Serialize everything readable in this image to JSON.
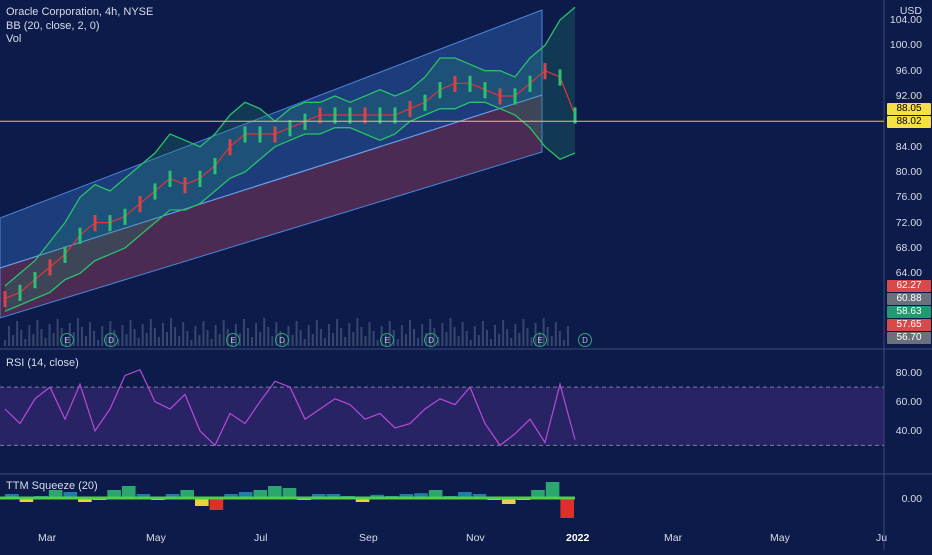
{
  "legend": {
    "title": "Oracle Corporation, 4h, NYSE",
    "bb": "BB (20, close, 2, 0)",
    "vol": "Vol",
    "rsi": "RSI (14, close)",
    "ttm": "TTM Squeeze (20)"
  },
  "currency": "USD",
  "price_axis": [
    "104.00",
    "100.00",
    "96.00",
    "92.00",
    "88.00",
    "84.00",
    "80.00",
    "76.00",
    "72.00",
    "68.00",
    "64.00"
  ],
  "price_tags": {
    "p1": "88.05",
    "p2": "88.02",
    "v1": "62.27",
    "v2": "60.88",
    "v3": "58.63",
    "v4": "57.65",
    "v5": "56.70"
  },
  "rsi_axis": [
    "80.00",
    "60.00",
    "40.00"
  ],
  "ttm_axis": "0.00",
  "x_axis": [
    "Mar",
    "May",
    "Jul",
    "Sep",
    "Nov",
    "2022",
    "Mar",
    "May",
    "Ju"
  ],
  "events": [
    "E",
    "D",
    "E",
    "D",
    "E",
    "D",
    "E",
    "D"
  ],
  "colors": {
    "background": "#0d1b4b",
    "channel_upper": "#2f66b8",
    "channel_lower": "#8a3b5c",
    "bb_band": "#27c36a",
    "bb_mid": "#e0343b",
    "rsi": "#b94ad6",
    "price_line": "#e8c84a",
    "tag_price": "#f5e046",
    "tag_red": "#d84a4a",
    "tag_gray": "#6c6f7c",
    "tag_green": "#1f9a73"
  },
  "chart_data": {
    "type": "line",
    "title": "Oracle Corporation, 4h, NYSE",
    "price_range": [
      60,
      106
    ],
    "last_price": 88.02,
    "bb_upper": [
      62,
      64,
      66,
      69,
      72,
      76,
      78,
      77,
      79,
      81,
      83,
      86,
      85,
      84,
      86,
      89,
      91,
      90,
      88,
      90,
      91,
      91,
      92,
      91,
      92,
      93,
      92,
      93,
      95,
      98,
      98,
      97,
      96,
      96,
      95,
      98,
      100,
      104,
      106
    ],
    "bb_mid": [
      60,
      61,
      63,
      65,
      67,
      70,
      72,
      72,
      73,
      75,
      77,
      79,
      78,
      79,
      81,
      84,
      86,
      86,
      86,
      87,
      88,
      89,
      89,
      89,
      89,
      89,
      89,
      90,
      91,
      93,
      94,
      94,
      93,
      92,
      92,
      94,
      96,
      95,
      89
    ],
    "bb_lower": [
      58,
      59,
      60,
      61,
      63,
      64,
      66,
      67,
      68,
      70,
      72,
      74,
      74,
      75,
      77,
      79,
      80,
      82,
      84,
      85,
      86,
      86,
      87,
      87,
      86,
      85,
      86,
      88,
      89,
      90,
      90,
      91,
      91,
      90,
      89,
      87,
      84,
      82,
      83
    ],
    "rsi_range": [
      20,
      90
    ],
    "rsi": [
      55,
      45,
      62,
      70,
      48,
      72,
      40,
      55,
      78,
      82,
      60,
      55,
      65,
      40,
      30,
      52,
      45,
      60,
      74,
      70,
      48,
      55,
      62,
      58,
      48,
      52,
      42,
      45,
      55,
      62,
      58,
      70,
      45,
      30,
      38,
      48,
      32,
      72,
      34
    ],
    "ttm": [
      1,
      -1,
      0.5,
      2,
      1.5,
      -1,
      -0.5,
      2,
      3,
      1,
      -0.5,
      1,
      2,
      -2,
      -3,
      1,
      1.5,
      2,
      3,
      2.5,
      -0.5,
      1,
      1,
      0.5,
      -1,
      0.8,
      0.5,
      1,
      1.2,
      2,
      0.5,
      1.5,
      1,
      -0.5,
      -1.5,
      -0.5,
      2,
      4,
      -5
    ]
  }
}
